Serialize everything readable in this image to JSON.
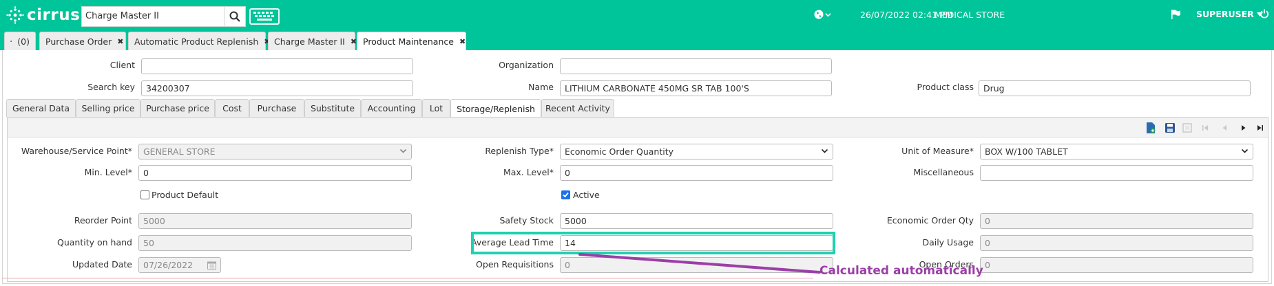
{
  "app": {
    "logo_text": "cirrus",
    "search_value": "Charge Master II",
    "datetime": "26/07/2022 02:41 PM",
    "store": "MEDICAL STORE",
    "user": "SUPERUSER"
  },
  "window_tabs": [
    {
      "label": "(0)"
    },
    {
      "label": "Purchase Order"
    },
    {
      "label": "Automatic Product Replenish"
    },
    {
      "label": "Charge Master II"
    },
    {
      "label": "Product Maintenance"
    }
  ],
  "header": {
    "client_label": "Client",
    "client_value": "",
    "organization_label": "Organization",
    "organization_value": "",
    "search_key_label": "Search key",
    "search_key_value": "34200307",
    "name_label": "Name",
    "name_value": "LITHIUM CARBONATE 450MG SR TAB 100'S",
    "product_class_label": "Product class",
    "product_class_value": "Drug"
  },
  "sub_tabs": [
    {
      "label": "General Data"
    },
    {
      "label": "Selling price"
    },
    {
      "label": "Purchase price"
    },
    {
      "label": "Cost"
    },
    {
      "label": "Purchase"
    },
    {
      "label": "Substitute"
    },
    {
      "label": "Accounting"
    },
    {
      "label": "Lot"
    },
    {
      "label": "Storage/Replenish"
    },
    {
      "label": "Recent Activity"
    }
  ],
  "form": {
    "warehouse_label": "Warehouse/Service Point*",
    "warehouse_value": "GENERAL STORE",
    "replenish_type_label": "Replenish Type*",
    "replenish_type_value": "Economic Order Quantity",
    "uom_label": "Unit of Measure*",
    "uom_value": "BOX W/100 TABLET",
    "min_level_label": "Min. Level*",
    "min_level_value": "0",
    "max_level_label": "Max. Level*",
    "max_level_value": "0",
    "misc_label": "Miscellaneous",
    "misc_value": "",
    "product_default_label": "Product Default",
    "product_default_checked": false,
    "active_label": "Active",
    "active_checked": true,
    "reorder_point_label": "Reorder Point",
    "reorder_point_value": "5000",
    "safety_stock_label": "Safety Stock",
    "safety_stock_value": "5000",
    "eoq_label": "Economic Order Qty",
    "eoq_value": "0",
    "qty_on_hand_label": "Quantity on hand",
    "qty_on_hand_value": "50",
    "avg_lead_time_label": "Average Lead Time",
    "avg_lead_time_value": "14",
    "daily_usage_label": "Daily Usage",
    "daily_usage_value": "0",
    "updated_date_label": "Updated Date",
    "updated_date_value": "07/26/2022",
    "open_requisitions_label": "Open Requisitions",
    "open_requisitions_value": "0",
    "open_orders_label": "Open Orders",
    "open_orders_value": "0"
  },
  "annotation": {
    "text": "Calculated automatically"
  },
  "colors": {
    "brand": "#00c49a",
    "highlight": "#1ed1b2",
    "annotation": "#9b3fa7"
  }
}
